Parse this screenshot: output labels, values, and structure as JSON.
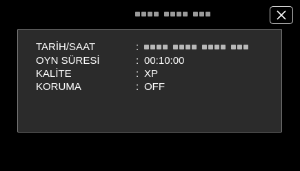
{
  "header": {
    "title_obscured": true
  },
  "close_button": {
    "icon": "close-icon"
  },
  "info": {
    "rows": [
      {
        "label": "TARİH/SAAT",
        "value": "",
        "value_obscured": true
      },
      {
        "label": "OYN SÜRESİ",
        "value": "00:10:00"
      },
      {
        "label": "KALİTE",
        "value": "XP"
      },
      {
        "label": "KORUMA",
        "value": "OFF"
      }
    ],
    "colon": ":"
  },
  "colors": {
    "background": "#000000",
    "panel": "#2b2b2b",
    "panel_border": "#7a7a7a",
    "text": "#ffffff"
  }
}
